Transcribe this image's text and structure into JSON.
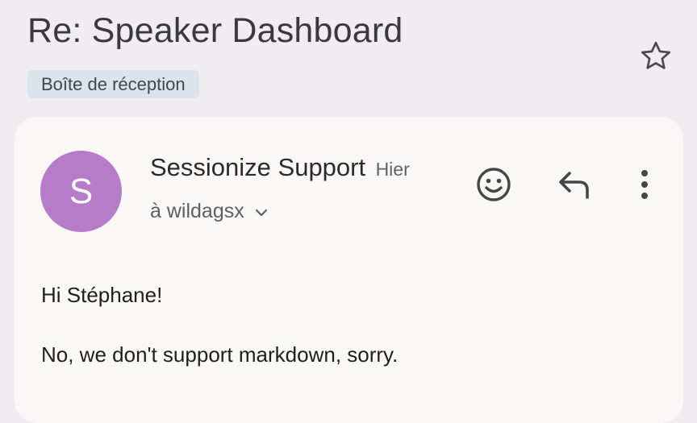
{
  "email": {
    "subject": "Re: Speaker Dashboard",
    "label": "Boîte de réception",
    "star_icon": "star-outline-icon"
  },
  "message": {
    "avatar_letter": "S",
    "avatar_color": "#b77cc9",
    "sender": "Sessionize Support",
    "time": "Hier",
    "recipient": "à wildagsx",
    "expand_icon": "chevron-down-icon",
    "actions": {
      "emoji_icon": "emoji-reaction-icon",
      "reply_icon": "reply-icon",
      "more_icon": "more-vert-icon"
    },
    "body": [
      "Hi Stéphane!",
      "No, we don't support markdown, sorry."
    ]
  },
  "colors": {
    "background": "#efedf1",
    "card": "#f9f8f6",
    "label_chip": "#dde3ea"
  }
}
